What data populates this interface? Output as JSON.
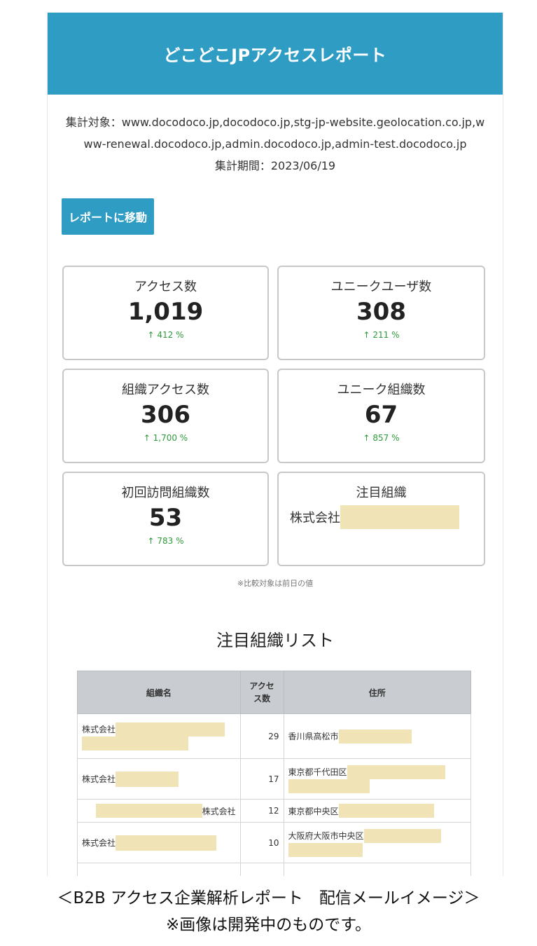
{
  "header": {
    "title": "どこどこJPアクセスレポート"
  },
  "meta": {
    "targets": "集計対象：www.docodoco.jp,docodoco.jp,stg-jp-website.geolocation.co.jp,www-renewal.docodoco.jp,admin.docodoco.jp,admin-test.docodoco.jp",
    "period": "集計期間：2023/06/19"
  },
  "report_button": "レポートに移動",
  "stats": {
    "access": {
      "label": "アクセス数",
      "value": "1,019",
      "change": "↑ 412 %"
    },
    "unique_users": {
      "label": "ユニークユーザ数",
      "value": "308",
      "change": "↑ 211 %"
    },
    "org_access": {
      "label": "組織アクセス数",
      "value": "306",
      "change": "↑ 1,700 %"
    },
    "unique_orgs": {
      "label": "ユニーク組織数",
      "value": "67",
      "change": "↑ 857 %"
    },
    "first_visit_orgs": {
      "label": "初回訪問組織数",
      "value": "53",
      "change": "↑ 783 %"
    },
    "featured_org": {
      "label": "注目組織",
      "prefix": "株式会社"
    }
  },
  "note": "※比較対象は前日の値",
  "list": {
    "title": "注目組織リスト",
    "headers": {
      "name": "組織名",
      "access": "アクセス数",
      "address": "住所"
    },
    "rows": [
      {
        "name_prefix": "株式会社",
        "name_suffix": "",
        "access": "29",
        "address": "香川県高松市"
      },
      {
        "name_prefix": "株式会社",
        "name_suffix": "",
        "access": "17",
        "address": "東京都千代田区"
      },
      {
        "name_prefix": "",
        "name_suffix": "株式会社",
        "access": "12",
        "address": "東京都中央区"
      },
      {
        "name_prefix": "株式会社",
        "name_suffix": "",
        "access": "10",
        "address": "大阪府大阪市中央区"
      }
    ]
  },
  "caption": {
    "line1": "＜B2B アクセス企業解析レポート　配信メールイメージ＞",
    "line2": "※画像は開発中のものです。"
  },
  "colors": {
    "header_bg": "#2f9cc4",
    "positive_change": "#2e9a3a",
    "redaction": "#f0e3b6",
    "table_header_bg": "#c9ccd1"
  }
}
